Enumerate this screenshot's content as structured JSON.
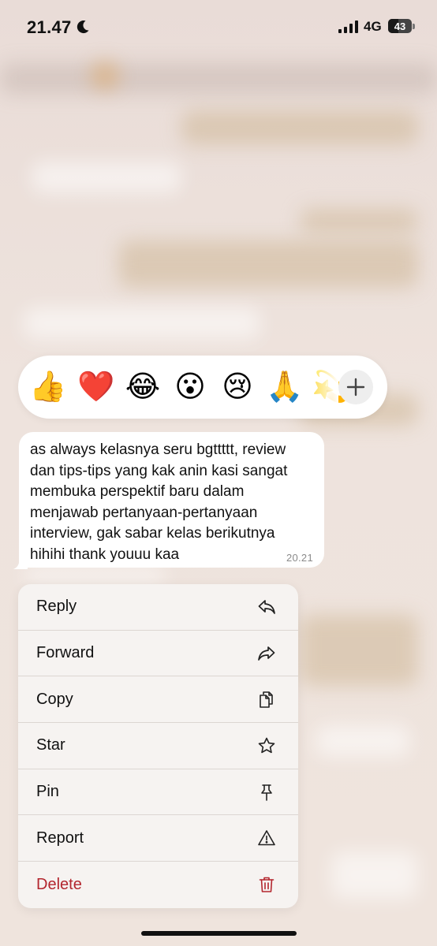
{
  "status_bar": {
    "time": "21.47",
    "network": "4G",
    "battery_level": "43",
    "battery_fraction": 0.43,
    "icons": [
      "moon-icon",
      "signal-icon",
      "battery-icon"
    ]
  },
  "reactions": {
    "emojis": [
      {
        "name": "thumbs-up",
        "glyph": "👍"
      },
      {
        "name": "red-heart",
        "glyph": "❤️"
      },
      {
        "name": "tears-of-joy",
        "glyph": "😂"
      },
      {
        "name": "surprised",
        "glyph": "😮"
      },
      {
        "name": "crying",
        "glyph": "😢"
      },
      {
        "name": "folded-hands",
        "glyph": "🙏"
      },
      {
        "name": "dizzy",
        "glyph": "💫"
      }
    ],
    "add_icon": "plus-icon"
  },
  "message": {
    "lines": [
      "as always kelasnya seru bgttttt, review",
      "dan tips-tips yang kak anin kasi sangat",
      "membuka perspektif baru dalam",
      "menjawab pertanyaan-pertanyaan",
      "interview, gak sabar kelas berikutnya",
      "hihihi thank youuu kaa"
    ],
    "time": "20.21"
  },
  "menu": {
    "items": [
      {
        "label": "Reply",
        "icon": "reply-icon"
      },
      {
        "label": "Forward",
        "icon": "forward-icon"
      },
      {
        "label": "Copy",
        "icon": "copy-icon"
      },
      {
        "label": "Star",
        "icon": "star-icon"
      },
      {
        "label": "Pin",
        "icon": "pin-icon"
      },
      {
        "label": "Report",
        "icon": "report-icon"
      },
      {
        "label": "Delete",
        "icon": "trash-icon"
      }
    ]
  },
  "colors": {
    "delete": "#b3262e",
    "menu_background": "#f6f3f1",
    "bubble_background": "#ffffff"
  }
}
